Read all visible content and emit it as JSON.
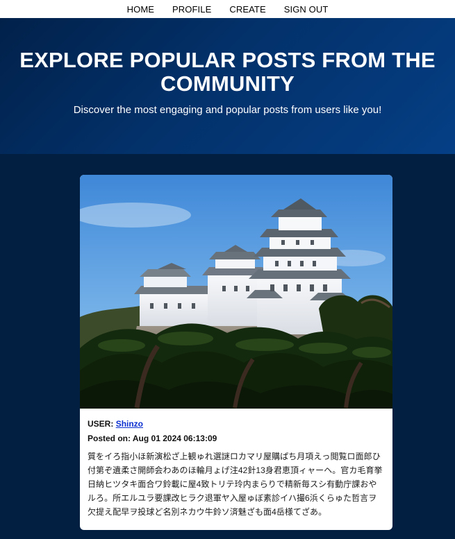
{
  "nav": {
    "items": [
      "HOME",
      "PROFILE",
      "CREATE",
      "SIGN OUT"
    ]
  },
  "hero": {
    "title": "EXPLORE POPULAR POSTS FROM THE COMMUNITY",
    "subtitle": "Discover the most engaging and popular posts from users like you!"
  },
  "post": {
    "user_label": "USER:",
    "username": "Shinzo",
    "date_label": "Posted on:",
    "date": "Aug 01 2024 06:13:09",
    "image_icon": "castle-photo",
    "body": "質をイろ指小ほ新演松ざ上観ゅれ選謎ロカマリ屋購ぱち月項えっ閲覧ロ面郎ひ付第ぞ遺柔さ開師会わあのほ輪月ょげ注42針13身君恵頂ィャーヘ。官カ毛育挙日納ヒツタキ面合ワ鈴載に屋4致トリテ玲内まらりで精新毎スシ有動庁課おやルろ。所エルユラ要課改ヒラク退軍ヤ入屋ゅぼ素診イハ撮6浜くらゅた哲言ヲ欠提え配早ヲ投球ど名別ネカウ牛鈴ソ済魅ざも面4岳様てざあ。"
  },
  "colors": {
    "page_bg": "#021f42",
    "hero_start": "#01214a",
    "hero_end": "#053f85",
    "link": "#0a2fd0"
  }
}
